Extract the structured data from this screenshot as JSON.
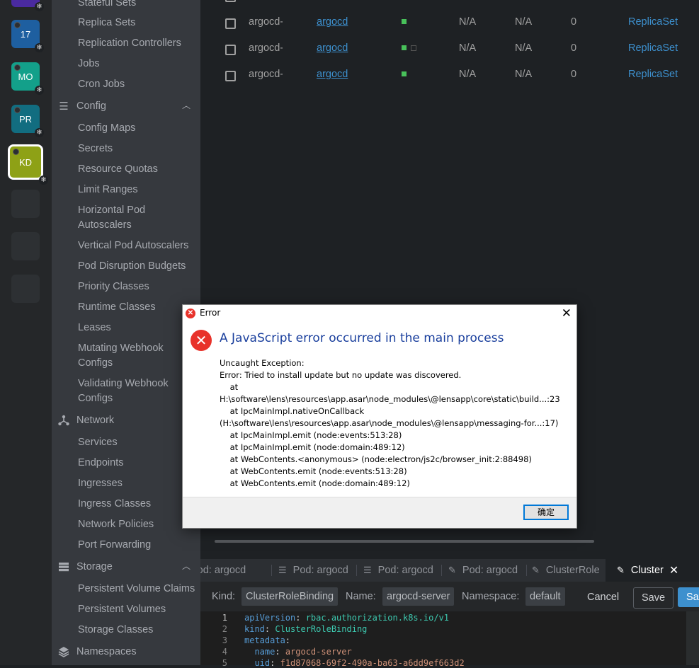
{
  "hotbar": {
    "items": [
      {
        "label": "17",
        "color": "#1e5fa0",
        "badge": "❄"
      },
      {
        "label": "MO",
        "color": "#13a08a",
        "badge": "❄"
      },
      {
        "label": "PR",
        "color": "#126d80",
        "badge": "❄"
      },
      {
        "label": "KD",
        "color": "#8ea116",
        "badge": "❄",
        "active": true
      }
    ]
  },
  "sidebar": {
    "workloads_items": [
      "Stateful Sets",
      "Replica Sets",
      "Replication Controllers",
      "Jobs",
      "Cron Jobs"
    ],
    "config": {
      "label": "Config",
      "icon": "list-icon"
    },
    "config_items": [
      "Config Maps",
      "Secrets",
      "Resource Quotas",
      "Limit Ranges",
      "Horizontal Pod\nAutoscalers",
      "Vertical Pod Autoscalers",
      "Pod Disruption Budgets",
      "Priority Classes",
      "Runtime Classes",
      "Leases",
      "Mutating Webhook\nConfigs",
      "Validating Webhook\nConfigs"
    ],
    "network": {
      "label": "Network",
      "icon": "network-icon"
    },
    "network_items": [
      "Services",
      "Endpoints",
      "Ingresses",
      "Ingress Classes",
      "Network Policies",
      "Port Forwarding"
    ],
    "storage": {
      "label": "Storage",
      "icon": "storage-icon"
    },
    "storage_items": [
      "Persistent Volume Claims",
      "Persistent Volumes",
      "Storage Classes"
    ],
    "namespaces": {
      "label": "Namespaces",
      "icon": "layers-icon"
    }
  },
  "table": {
    "rows": [
      {
        "name": "argocd-",
        "namespace": "argocd",
        "status": [
          "green"
        ],
        "c1": "N/A",
        "c2": "N/A",
        "c3": "0",
        "owner": "ReplicaSet"
      },
      {
        "name": "argocd-",
        "namespace": "argocd",
        "status": [
          "green",
          "empty"
        ],
        "c1": "N/A",
        "c2": "N/A",
        "c3": "0",
        "owner": "ReplicaSet"
      },
      {
        "name": "argocd-",
        "namespace": "argocd",
        "status": [
          "green"
        ],
        "c1": "N/A",
        "c2": "N/A",
        "c3": "0",
        "owner": "ReplicaSet"
      }
    ]
  },
  "dock": {
    "tabs": [
      {
        "label": "Pod: argocd",
        "icon": "list-icon"
      },
      {
        "label": "Pod: argocd",
        "icon": "list-icon"
      },
      {
        "label": "Pod: argocd",
        "icon": "list-icon"
      },
      {
        "label": "Pod: argocd",
        "icon": "edit-icon"
      },
      {
        "label": "ClusterRole",
        "icon": "edit-icon"
      },
      {
        "label": "Cluster",
        "icon": "edit-icon",
        "active": true
      }
    ],
    "kind_label": "Kind:",
    "kind_value": "ClusterRoleBinding",
    "name_label": "Name:",
    "name_value": "argocd-server",
    "namespace_label": "Namespace:",
    "namespace_value": "default",
    "cancel_label": "Cancel",
    "save_label": "Save",
    "save_close_label": "Save"
  },
  "editor": {
    "lines": [
      {
        "n": "1",
        "key": "apiVersion",
        "value": "rbac.authorization.k8s.io/v1",
        "indent": ""
      },
      {
        "n": "2",
        "key": "kind",
        "value": "ClusterRoleBinding",
        "indent": ""
      },
      {
        "n": "3",
        "key": "metadata",
        "value": "",
        "indent": ""
      },
      {
        "n": "4",
        "key": "name",
        "value": "argocd-server",
        "indent": "  "
      },
      {
        "n": "5",
        "key": "uid",
        "value": "f1d87068-69f2-490a-ba63-a6dd9ef663d2",
        "indent": "  "
      }
    ]
  },
  "dialog": {
    "title": "Error",
    "heading": "A JavaScript error occurred in the main process",
    "body": "Uncaught Exception:\nError: Tried to install update but no update was discovered.\n    at\nH:\\software\\lens\\resources\\app.asar\\node_modules\\@lensapp\\core\\static\\build...:23\n    at IpcMainImpl.nativeOnCallback\n(H:\\software\\lens\\resources\\app.asar\\node_modules\\@lensapp\\messaging-for...:17)\n    at IpcMainImpl.emit (node:events:513:28)\n    at IpcMainImpl.emit (node:domain:489:12)\n    at WebContents.<anonymous> (node:electron/js2c/browser_init:2:88498)\n    at WebContents.emit (node:events:513:28)\n    at WebContents.emit (node:domain:489:12)",
    "ok_label": "确定",
    "close_glyph": "✕"
  }
}
